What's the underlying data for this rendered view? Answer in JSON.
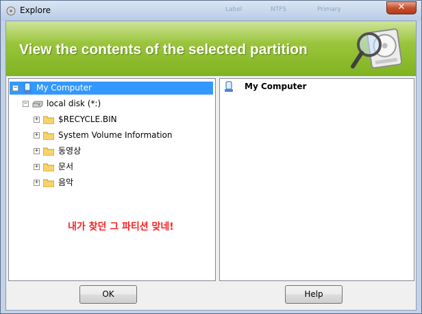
{
  "window": {
    "title": "Explore",
    "ghost": [
      "Label",
      "NTFS",
      "Primary"
    ],
    "close_label": "✕"
  },
  "banner": {
    "title": "View the contents of the selected partition"
  },
  "tree": {
    "root": {
      "label": "My Computer",
      "expander": "−"
    },
    "disk": {
      "label": "local disk (*:)",
      "expander": "−"
    },
    "folders": [
      {
        "label": "$RECYCLE.BIN",
        "expander": "+"
      },
      {
        "label": "System Volume Information",
        "expander": "+"
      },
      {
        "label": "동영상",
        "expander": "+"
      },
      {
        "label": "문서",
        "expander": "+"
      },
      {
        "label": "음악",
        "expander": "+"
      }
    ]
  },
  "annotation": {
    "text": "내가 찾던 그 파티션 맞네!"
  },
  "detail": {
    "header": "My Computer"
  },
  "buttons": {
    "ok": "OK",
    "help": "Help"
  },
  "colors": {
    "banner_green": "#8bbb2c",
    "selection": "#3399ff",
    "annotation": "#ff1e1e"
  }
}
